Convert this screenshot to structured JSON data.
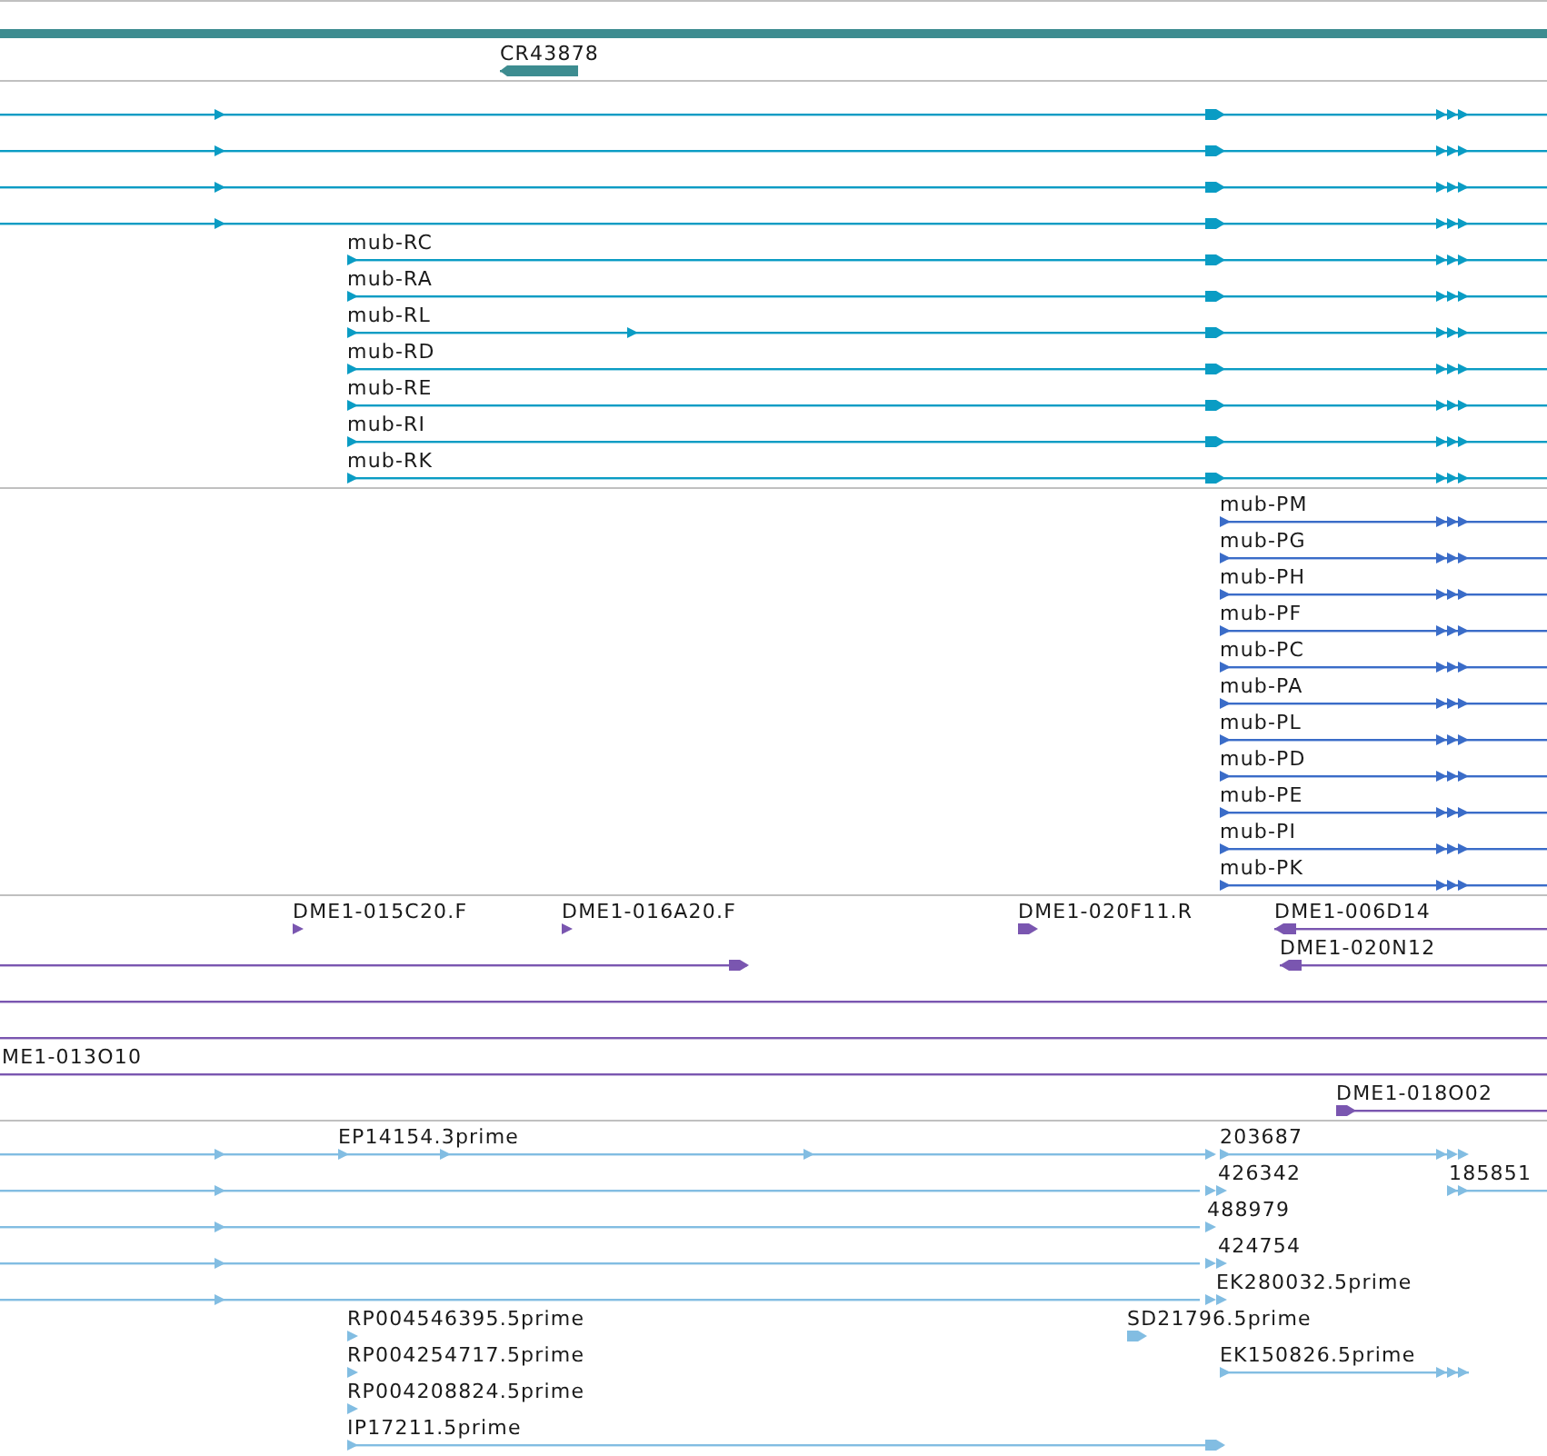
{
  "tracks": [
    {
      "kind": "gene",
      "rows": [
        {
          "features": [
            {
              "label": "CR43878",
              "reverse": true
            }
          ]
        }
      ]
    },
    {
      "kind": "transcript",
      "rows": [
        {
          "features": [
            {
              "reverse": false
            }
          ]
        },
        {
          "features": [
            {
              "reverse": false
            }
          ]
        },
        {
          "features": [
            {
              "reverse": false
            }
          ]
        },
        {
          "features": [
            {
              "reverse": false
            }
          ]
        },
        {
          "features": [
            {
              "label": "mub-RC",
              "reverse": false
            }
          ]
        },
        {
          "features": [
            {
              "label": "mub-RA",
              "reverse": false
            }
          ]
        },
        {
          "features": [
            {
              "label": "mub-RL",
              "reverse": false
            }
          ]
        },
        {
          "features": [
            {
              "label": "mub-RD",
              "reverse": false
            }
          ]
        },
        {
          "features": [
            {
              "label": "mub-RE",
              "reverse": false
            }
          ]
        },
        {
          "features": [
            {
              "label": "mub-RI",
              "reverse": false
            }
          ]
        },
        {
          "features": [
            {
              "label": "mub-RK",
              "reverse": false
            }
          ]
        }
      ]
    },
    {
      "kind": "protein",
      "rows": [
        {
          "features": [
            {
              "label": "mub-PM",
              "reverse": false
            }
          ]
        },
        {
          "features": [
            {
              "label": "mub-PG",
              "reverse": false
            }
          ]
        },
        {
          "features": [
            {
              "label": "mub-PH",
              "reverse": false
            }
          ]
        },
        {
          "features": [
            {
              "label": "mub-PF",
              "reverse": false
            }
          ]
        },
        {
          "features": [
            {
              "label": "mub-PC",
              "reverse": false
            }
          ]
        },
        {
          "features": [
            {
              "label": "mub-PA",
              "reverse": false
            }
          ]
        },
        {
          "features": [
            {
              "label": "mub-PL",
              "reverse": false
            }
          ]
        },
        {
          "features": [
            {
              "label": "mub-PD",
              "reverse": false
            }
          ]
        },
        {
          "features": [
            {
              "label": "mub-PE",
              "reverse": false
            }
          ]
        },
        {
          "features": [
            {
              "label": "mub-PI",
              "reverse": false
            }
          ]
        },
        {
          "features": [
            {
              "label": "mub-PK",
              "reverse": false
            }
          ]
        }
      ]
    },
    {
      "kind": "clone",
      "rows": [
        {
          "features": [
            {
              "kind": "arrowed",
              "label": "DME1-015C20.F",
              "reverse": false
            },
            {
              "kind": "arrowed",
              "label": "DME1-016A20.F",
              "reverse": false
            },
            {
              "kind": "arrowed",
              "label": "DME1-020F11.R",
              "reverse": false
            },
            {
              "kind": "arrowed",
              "label": "DME1-006D14",
              "reverse": true
            }
          ]
        },
        {
          "features": [
            {
              "kind": "arrowed",
              "reverse": false
            },
            {
              "kind": "arrowed",
              "label": "DME1-020N12",
              "reverse": true
            }
          ]
        },
        {
          "features": [
            {
              "kind": "plain"
            }
          ]
        },
        {
          "features": [
            {
              "kind": "plain"
            }
          ]
        },
        {
          "features": [
            {
              "kind": "plain",
              "label": "ME1-013O10"
            }
          ]
        },
        {
          "features": [
            {
              "kind": "arrowed",
              "label": "DME1-018O02",
              "reverse": false
            }
          ]
        }
      ]
    },
    {
      "kind": "est",
      "rows": [
        {
          "features": [
            {
              "reverse": false
            },
            {
              "label": "EP14154.3prime",
              "reverse": false
            },
            {
              "label": "203687",
              "reverse": false
            }
          ]
        },
        {
          "features": [
            {
              "reverse": false
            },
            {
              "label": "426342",
              "reverse": false
            },
            {
              "label": "185851",
              "reverse": false
            }
          ]
        },
        {
          "features": [
            {
              "reverse": false
            },
            {
              "label": "488979",
              "reverse": false
            }
          ]
        },
        {
          "features": [
            {
              "reverse": false
            },
            {
              "label": "424754",
              "reverse": false
            }
          ]
        },
        {
          "features": [
            {
              "reverse": false
            },
            {
              "label": "EK280032.5prime",
              "reverse": false
            }
          ]
        },
        {
          "features": [
            {
              "label": "RP004546395.5prime",
              "reverse": false
            },
            {
              "label": "SD21796.5prime",
              "reverse": false
            }
          ]
        },
        {
          "features": [
            {
              "label": "RP004254717.5prime",
              "reverse": false
            },
            {
              "label": "EK150826.5prime",
              "reverse": false
            }
          ]
        },
        {
          "features": [
            {
              "label": "RP004208824.5prime",
              "reverse": false
            }
          ]
        },
        {
          "features": [
            {
              "label": "IP17211.5prime",
              "reverse": false
            }
          ]
        }
      ]
    }
  ]
}
